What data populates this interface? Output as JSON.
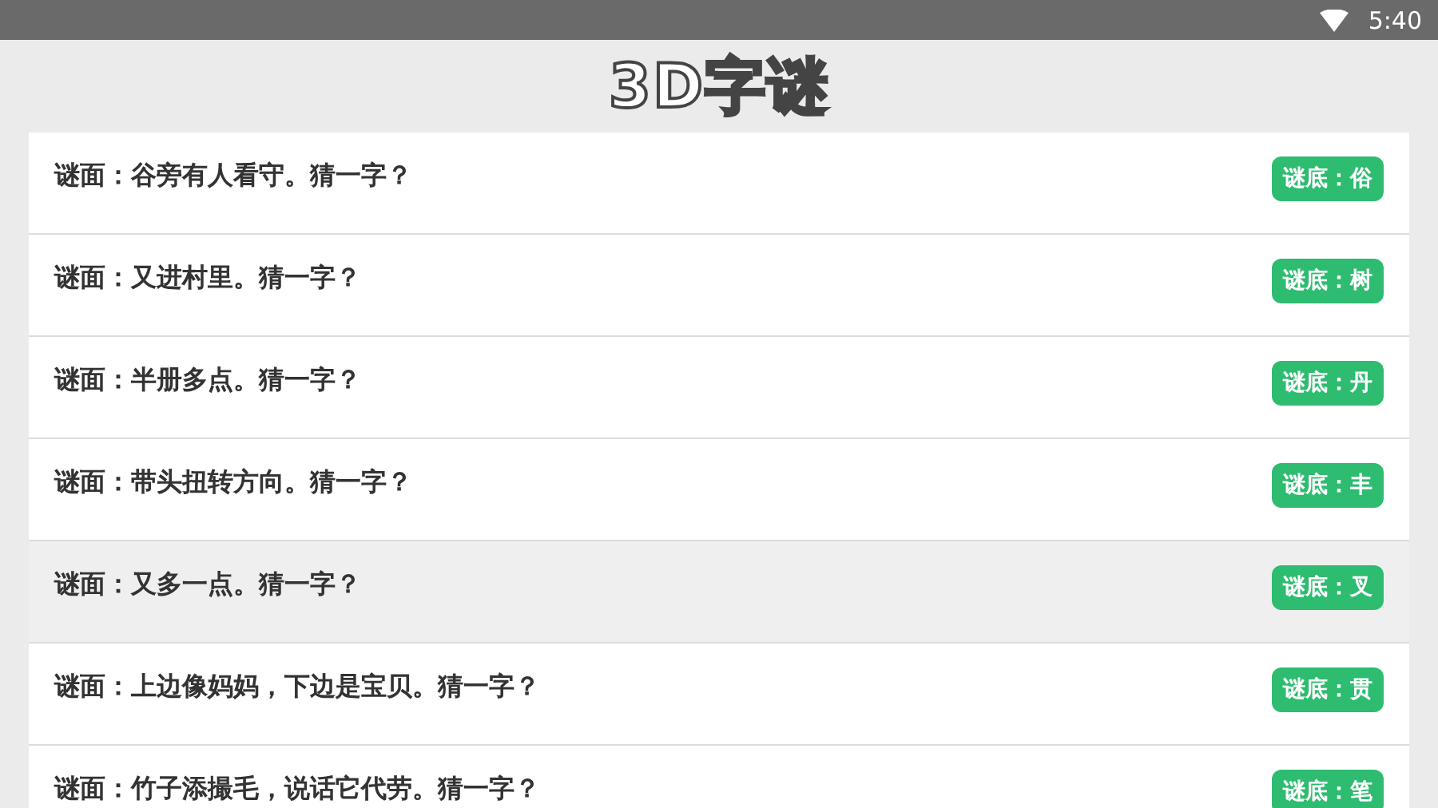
{
  "status_bar": {
    "time": "5:40"
  },
  "title": "3D字谜",
  "riddles": [
    {
      "question": "谜面：谷旁有人看守。猜一字？",
      "answer": "谜底：俗",
      "selected": false
    },
    {
      "question": "谜面：又进村里。猜一字？",
      "answer": "谜底：树",
      "selected": false
    },
    {
      "question": "谜面：半册多点。猜一字？",
      "answer": "谜底：丹",
      "selected": false
    },
    {
      "question": "谜面：带头扭转方向。猜一字？",
      "answer": "谜底：丰",
      "selected": false
    },
    {
      "question": "谜面：又多一点。猜一字？",
      "answer": "谜底：叉",
      "selected": true
    },
    {
      "question": "谜面：上边像妈妈，下边是宝贝。猜一字？",
      "answer": "谜底：贯",
      "selected": false
    },
    {
      "question": "谜面：竹子添撮毛，说话它代劳。猜一字？",
      "answer": "谜底：笔",
      "selected": false
    }
  ]
}
